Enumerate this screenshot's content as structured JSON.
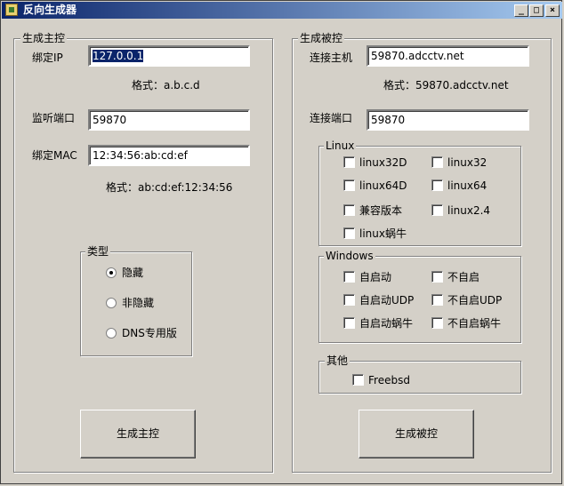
{
  "window": {
    "title": "反向生成器",
    "minimize": "_",
    "maximize": "□",
    "close": "×"
  },
  "left": {
    "group_title": "生成主控",
    "bind_ip_label": "绑定IP",
    "bind_ip_value": "127.0.0.1",
    "ip_format": "格式：a.b.c.d",
    "listen_port_label": "监听端口",
    "listen_port_value": "59870",
    "bind_mac_label": "绑定MAC",
    "bind_mac_value": "12:34:56:ab:cd:ef",
    "mac_format": "格式：ab:cd:ef:12:34:56",
    "type_group": {
      "title": "类型",
      "options": [
        "隐藏",
        "非隐藏",
        "DNS专用版"
      ],
      "selected": "隐藏"
    },
    "generate_button": "生成主控"
  },
  "right": {
    "group_title": "生成被控",
    "connect_host_label": "连接主机",
    "connect_host_value": "59870.adcctv.net",
    "host_format": "格式：59870.adcctv.net",
    "connect_port_label": "连接端口",
    "connect_port_value": "59870",
    "linux_group": {
      "title": "Linux",
      "items": [
        "linux32D",
        "linux32",
        "linux64D",
        "linux64",
        "兼容版本",
        "linux2.4",
        "linux蜗牛"
      ]
    },
    "windows_group": {
      "title": "Windows",
      "items": [
        "自启动",
        "不自启",
        "自启动UDP",
        "不自启UDP",
        "自启动蜗牛",
        "不自启蜗牛"
      ]
    },
    "other_group": {
      "title": "其他",
      "items": [
        "Freebsd"
      ]
    },
    "generate_button": "生成被控"
  }
}
